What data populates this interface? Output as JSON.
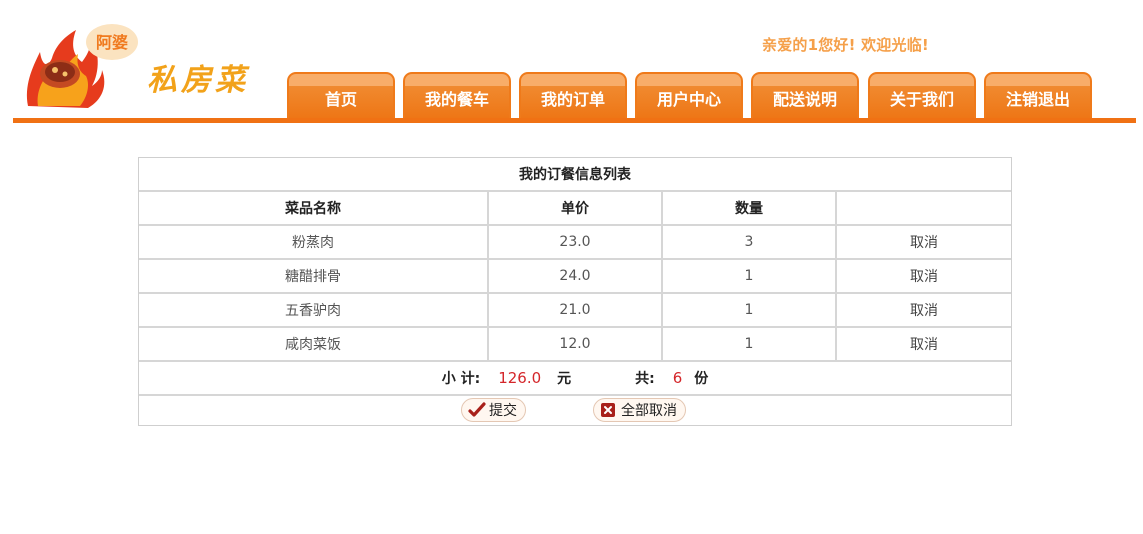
{
  "header": {
    "logo_badge": "阿婆",
    "logo_text": "私房菜",
    "welcome": "亲爱的1您好!  欢迎光临!"
  },
  "nav": {
    "tabs": [
      "首页",
      "我的餐车",
      "我的订单",
      "用户中心",
      "配送说明",
      "关于我们",
      "注销退出"
    ]
  },
  "orders": {
    "caption": "我的订餐信息列表",
    "columns": [
      "菜品名称",
      "单价",
      "数量",
      ""
    ],
    "rows": [
      {
        "name": "粉蒸肉",
        "price": "23.0",
        "qty": "3",
        "action": "取消"
      },
      {
        "name": "糖醋排骨",
        "price": "24.0",
        "qty": "1",
        "action": "取消"
      },
      {
        "name": "五香驴肉",
        "price": "21.0",
        "qty": "1",
        "action": "取消"
      },
      {
        "name": "咸肉菜饭",
        "price": "12.0",
        "qty": "1",
        "action": "取消"
      }
    ],
    "summary": {
      "subtotal_label": "小 计:",
      "subtotal_value": "126.0",
      "currency_unit": "元",
      "count_label": "共:",
      "count_value": "6",
      "count_unit": "份"
    },
    "buttons": {
      "submit": "提交",
      "cancel_all": "全部取消"
    }
  },
  "colors": {
    "accent": "#f07114",
    "tab_light": "#f8ad69",
    "welcome": "#f5a04a",
    "highlight_red": "#d4262a"
  }
}
